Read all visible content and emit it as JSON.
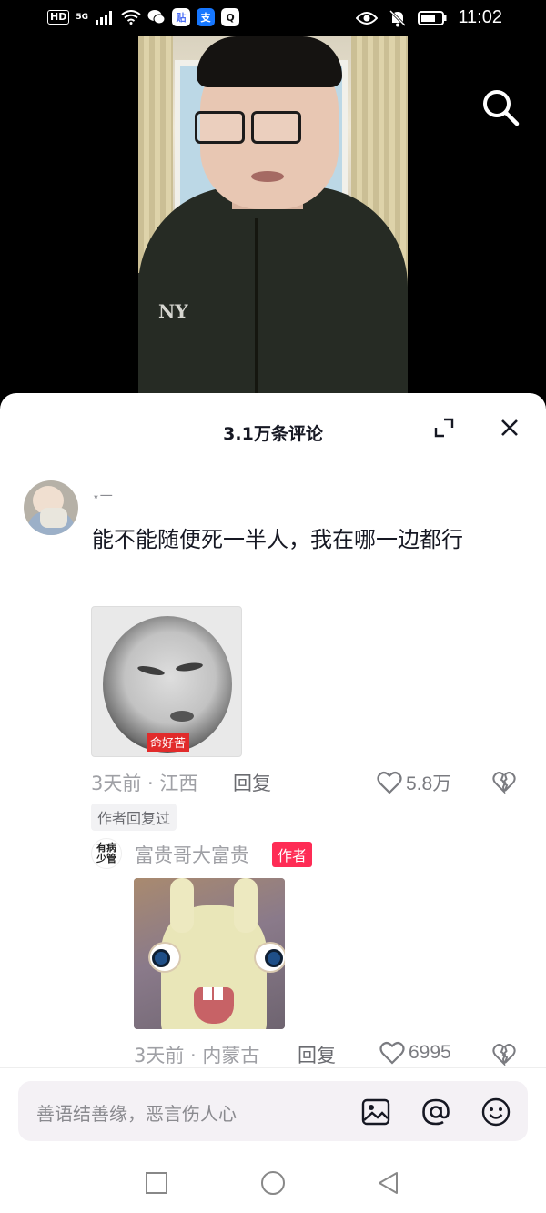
{
  "status_bar": {
    "hd": "HD",
    "network": "5G",
    "app_icons": [
      {
        "glyph": "贴",
        "color": "#4c6ef5"
      },
      {
        "glyph": "支",
        "color": "#1677ff"
      },
      {
        "glyph": "Q",
        "color": "#ffffff"
      }
    ],
    "time": "11:02"
  },
  "video": {
    "background": "#000000"
  },
  "comments_panel": {
    "title": "3.1万条评论"
  },
  "comment": {
    "username": "⋆一",
    "text": "能不能随便死一半人，我在哪一边都行",
    "sticker_caption": "命好苦",
    "time_location": "3天前 · 江西",
    "reply_label": "回复",
    "like_count": "5.8万",
    "author_replied_tag": "作者回复过"
  },
  "reply": {
    "avatar_text": "有病少管",
    "username": "富贵哥大富贵",
    "author_badge": "作者",
    "time_location": "3天前 · 内蒙古",
    "reply_label": "回复",
    "like_count": "6995"
  },
  "input_bar": {
    "placeholder": "善语结善缘，恶言伤人心"
  },
  "colors": {
    "accent": "#fe2c55",
    "meta_text": "#9fa0a5"
  }
}
